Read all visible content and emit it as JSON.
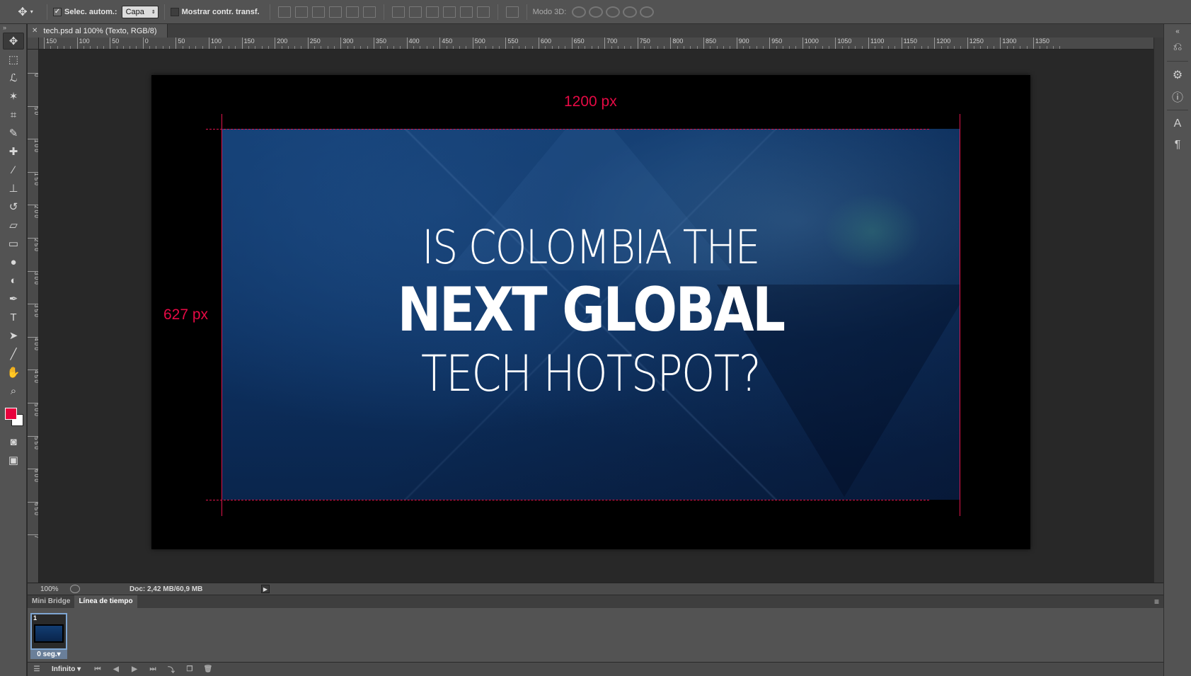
{
  "options_bar": {
    "auto_select_label": "Selec. autom.:",
    "auto_select_checked": true,
    "auto_select_value": "Capa",
    "show_transform_label": "Mostrar contr. transf.",
    "show_transform_checked": false,
    "mode_3d_label": "Modo 3D:"
  },
  "document": {
    "tab_title": "tech.psd al 100% (Texto, RGB/8)",
    "headline_line1": "IS COLOMBIA THE",
    "headline_line2": "NEXT GLOBAL",
    "headline_line3": "TECH HOTSPOT?",
    "width_label": "1200 px",
    "height_label": "627 px",
    "guide_color": "#e0144c"
  },
  "rulers": {
    "top_labels": [
      "150",
      "100",
      "50",
      "0",
      "50",
      "100",
      "150",
      "200",
      "250",
      "300",
      "350",
      "400",
      "450",
      "500",
      "550",
      "600",
      "650",
      "700",
      "750",
      "800",
      "850",
      "900",
      "950",
      "1000",
      "1050",
      "1100",
      "1150",
      "1200",
      "1250",
      "1300",
      "1350"
    ],
    "left_labels": [
      "0",
      "5 0",
      "1 0 0",
      "1 5 0",
      "2 0 0",
      "2 5 0",
      "3 0 0",
      "3 5 0",
      "4 0 0",
      "4 5 0",
      "5 0 0",
      "5 5 0",
      "6 0 0",
      "6 5 0",
      "7"
    ]
  },
  "status_bar": {
    "zoom": "100%",
    "doc_size": "Doc: 2,42 MB/60,9 MB"
  },
  "bottom_panel": {
    "tabs": [
      "Mini Bridge",
      "Línea de tiempo"
    ],
    "active_tab": "Línea de tiempo",
    "frame_number": "1",
    "frame_delay": "0 seg.",
    "loop_option": "Infinito"
  },
  "colors": {
    "foreground": "#e8003d",
    "background": "#ffffff"
  },
  "icons": {
    "tools": [
      "move-icon",
      "marquee-icon",
      "lasso-icon",
      "magic-wand-icon",
      "crop-icon",
      "eyedropper-icon",
      "healing-brush-icon",
      "brush-icon",
      "stamp-icon",
      "history-brush-icon",
      "eraser-icon",
      "gradient-icon",
      "blur-icon",
      "dodge-icon",
      "pen-icon",
      "type-icon",
      "path-selection-icon",
      "line-icon",
      "hand-icon",
      "zoom-icon"
    ]
  }
}
